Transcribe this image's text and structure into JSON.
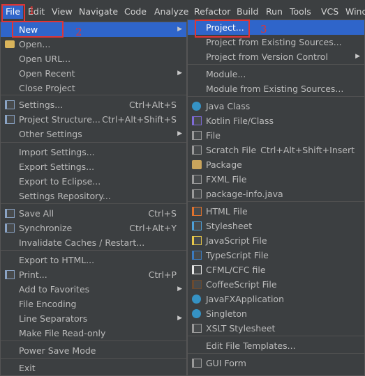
{
  "menubar": {
    "items": [
      "File",
      "Edit",
      "View",
      "Navigate",
      "Code",
      "Analyze",
      "Refactor",
      "Build",
      "Run",
      "Tools",
      "VCS",
      "Wind"
    ]
  },
  "file_menu": {
    "items": [
      {
        "label": "New",
        "shortcut": "",
        "submenu": true,
        "highlighted": true,
        "icon": ""
      },
      {
        "label": "Open...",
        "shortcut": "",
        "icon": "folder-icon"
      },
      {
        "label": "Open URL...",
        "shortcut": ""
      },
      {
        "label": "Open Recent",
        "shortcut": "",
        "submenu": true
      },
      {
        "label": "Close Project",
        "shortcut": ""
      },
      {
        "label": "Settings...",
        "shortcut": "Ctrl+Alt+S",
        "icon": "wrench-icon"
      },
      {
        "label": "Project Structure...",
        "shortcut": "Ctrl+Alt+Shift+S",
        "icon": "project-structure-icon"
      },
      {
        "label": "Other Settings",
        "shortcut": "",
        "submenu": true
      },
      {
        "label": "Import Settings...",
        "shortcut": ""
      },
      {
        "label": "Export Settings...",
        "shortcut": ""
      },
      {
        "label": "Export to Eclipse...",
        "shortcut": ""
      },
      {
        "label": "Settings Repository...",
        "shortcut": ""
      },
      {
        "label": "Save All",
        "shortcut": "Ctrl+S",
        "icon": "save-icon"
      },
      {
        "label": "Synchronize",
        "shortcut": "Ctrl+Alt+Y",
        "icon": "sync-icon"
      },
      {
        "label": "Invalidate Caches / Restart...",
        "shortcut": ""
      },
      {
        "label": "Export to HTML...",
        "shortcut": ""
      },
      {
        "label": "Print...",
        "shortcut": "Ctrl+P",
        "icon": "print-icon"
      },
      {
        "label": "Add to Favorites",
        "shortcut": "",
        "submenu": true
      },
      {
        "label": "File Encoding",
        "shortcut": ""
      },
      {
        "label": "Line Separators",
        "shortcut": "",
        "submenu": true
      },
      {
        "label": "Make File Read-only",
        "shortcut": ""
      },
      {
        "label": "Power Save Mode",
        "shortcut": ""
      },
      {
        "label": "Exit",
        "shortcut": ""
      }
    ]
  },
  "new_submenu": {
    "items": [
      {
        "label": "Project...",
        "shortcut": "",
        "highlighted": true
      },
      {
        "label": "Project from Existing Sources...",
        "shortcut": ""
      },
      {
        "label": "Project from Version Control",
        "shortcut": "",
        "submenu": true
      },
      {
        "label": "Module...",
        "shortcut": ""
      },
      {
        "label": "Module from Existing Sources...",
        "shortcut": ""
      },
      {
        "label": "Java Class",
        "shortcut": "",
        "icon": "java-class-icon",
        "color": "#3592c4"
      },
      {
        "label": "Kotlin File/Class",
        "shortcut": "",
        "icon": "kotlin-icon",
        "color": "#7f6bd8"
      },
      {
        "label": "File",
        "shortcut": "",
        "icon": "file-icon",
        "color": "#9a9a9a"
      },
      {
        "label": "Scratch File",
        "shortcut": "Ctrl+Alt+Shift+Insert",
        "icon": "scratch-file-icon",
        "color": "#9a9a9a"
      },
      {
        "label": "Package",
        "shortcut": "",
        "icon": "package-icon",
        "color": "#c9a45c"
      },
      {
        "label": "FXML File",
        "shortcut": "",
        "icon": "fxml-icon",
        "color": "#9a9a9a"
      },
      {
        "label": "package-info.java",
        "shortcut": "",
        "icon": "java-file-icon",
        "color": "#9a9a9a"
      },
      {
        "label": "HTML File",
        "shortcut": "",
        "icon": "html-icon",
        "color": "#e0722d"
      },
      {
        "label": "Stylesheet",
        "shortcut": "",
        "icon": "css-icon",
        "color": "#4ea0d8"
      },
      {
        "label": "JavaScript File",
        "shortcut": "",
        "icon": "js-icon",
        "color": "#e8c84a"
      },
      {
        "label": "TypeScript File",
        "shortcut": "",
        "icon": "ts-icon",
        "color": "#3b7bc0"
      },
      {
        "label": "CFML/CFC file",
        "shortcut": "",
        "icon": "cf-icon",
        "color": "#e8e8e8"
      },
      {
        "label": "CoffeeScript File",
        "shortcut": "",
        "icon": "coffee-icon",
        "color": "#6b4a2f"
      },
      {
        "label": "JavaFXApplication",
        "shortcut": "",
        "icon": "javafx-icon",
        "color": "#3592c4"
      },
      {
        "label": "Singleton",
        "shortcut": "",
        "icon": "singleton-icon",
        "color": "#3592c4"
      },
      {
        "label": "XSLT Stylesheet",
        "shortcut": "",
        "icon": "xslt-icon",
        "color": "#9a9a9a"
      },
      {
        "label": "Edit File Templates...",
        "shortcut": ""
      },
      {
        "label": "GUI Form",
        "shortcut": "",
        "icon": "gui-form-icon",
        "color": "#9a9a9a"
      }
    ]
  },
  "annotations": [
    "1",
    "2",
    "3"
  ]
}
